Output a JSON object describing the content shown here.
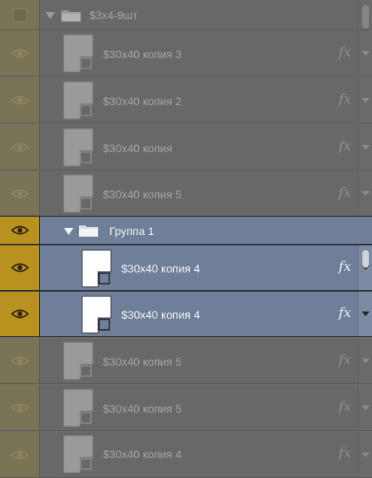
{
  "layers_panel": {
    "group_top": {
      "label": "$3x4-9шт",
      "icon": "folder-icon",
      "expand_icon": "disclosure-triangle-icon",
      "visibility": "checkbox-empty"
    },
    "layers_above": [
      {
        "label": "$30x40 копия 3",
        "fx": "fx"
      },
      {
        "label": "$30x40 копия 2",
        "fx": "fx"
      },
      {
        "label": "$30x40 копия",
        "fx": "fx"
      },
      {
        "label": "$30x40 копия 5",
        "fx": "fx"
      }
    ],
    "group_selected": {
      "label": "Группа 1",
      "icon": "folder-icon",
      "expand_icon": "disclosure-triangle-icon"
    },
    "layers_selected": [
      {
        "label": "$30x40 копия 4",
        "fx": "fx"
      },
      {
        "label": "$30x40 копия 4",
        "fx": "fx"
      }
    ],
    "layers_below": [
      {
        "label": "$30x40 копия 5",
        "fx": "fx"
      },
      {
        "label": "$30x40 копия 5",
        "fx": "fx"
      },
      {
        "label": "$30x40 копия 4",
        "fx": "fx"
      }
    ],
    "colors": {
      "selection": "#6f7f99",
      "eye_active": "#b8911f",
      "eye_dim": "#7a7457"
    }
  }
}
